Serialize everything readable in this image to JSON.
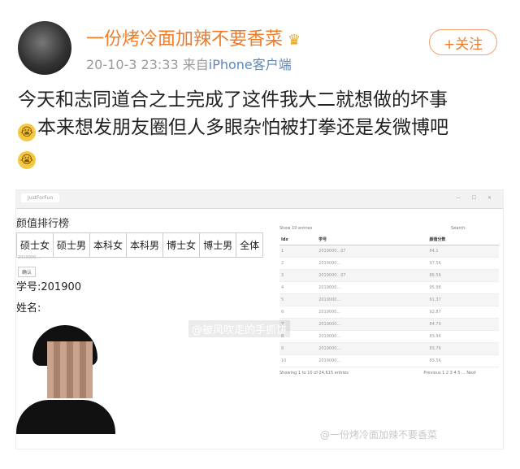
{
  "user": {
    "name": "一份烤冷面加辣不要香菜",
    "badge_icon": "crown-icon"
  },
  "meta": {
    "date": "20-10-3 23:33",
    "source_prefix": "来自",
    "source": "iPhone客户端"
  },
  "follow": {
    "label": "+关注"
  },
  "post": {
    "line1": "今天和志同道合之士完成了这件我大二就想做的坏事",
    "line2": "本来想发朋友圈但人多眼杂怕被打拳还是发微博吧",
    "emoji_icon": "crying-face-icon"
  },
  "screenshot": {
    "tab_label": "JustForFun",
    "page_title": "颜值排行榜",
    "categories": [
      "硕士女",
      "硕士男",
      "本科女",
      "本科男",
      "博士女",
      "博士男",
      "全体"
    ],
    "input_value": "2019000...",
    "ok_label": "确认",
    "student_id": "学号:201900",
    "student_name": "姓名:",
    "table": {
      "show_label": "Show 10 entries",
      "search_label": "Search:",
      "headers": [
        "Idx",
        "学号",
        "颜值分数"
      ],
      "rows": [
        [
          "1",
          "2019000...07",
          "84.1"
        ],
        [
          "2",
          "2019000...",
          "97.56"
        ],
        [
          "3",
          "2019000...07",
          "86.56"
        ],
        [
          "4",
          "2019000...",
          "95.98"
        ],
        [
          "5",
          "2019000...",
          "91.37"
        ],
        [
          "6",
          "2019000...",
          "92.87"
        ],
        [
          "7",
          "2019000...",
          "84.79"
        ],
        [
          "8",
          "2019000...",
          "83.96"
        ],
        [
          "9",
          "2019000...",
          "83.76"
        ],
        [
          "10",
          "2019000...",
          "83.56"
        ]
      ],
      "info": "Showing 1 to 10 of 24,615 entries",
      "pagination": "Previous  1  2  3  4  5  ...  Next"
    }
  },
  "watermarks": {
    "center": "@被风吹走的手抓饼",
    "bottom": "@一份烤冷面加辣不要香菜"
  }
}
